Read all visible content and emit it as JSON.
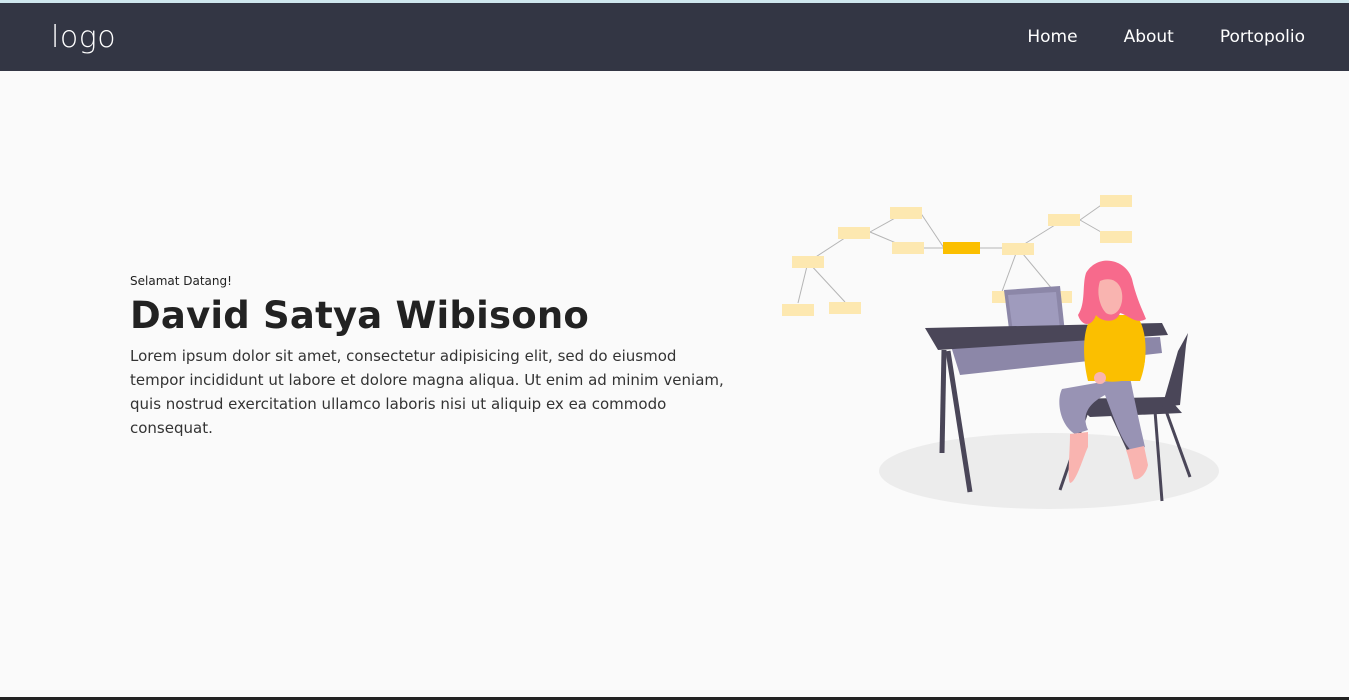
{
  "navbar": {
    "logo": "logo",
    "links": [
      {
        "label": "Home"
      },
      {
        "label": "About"
      },
      {
        "label": "Portopolio"
      }
    ]
  },
  "hero": {
    "greeting": "Selamat Datang!",
    "name": "David Satya Wibisono",
    "description": "Lorem ipsum dolor sit amet, consectetur adipisicing elit, sed do eiusmod tempor incididunt ut labore et dolore magna aliqua. Ut enim ad minim veniam, quis nostrud exercitation ullamco laboris nisi ut aliquip ex ea commodo consequat."
  },
  "illustration": {
    "name": "woman-at-desk-illustration",
    "colors": {
      "accent": "#fbbf00",
      "note": "#fde8b0",
      "desk": "#4a4658",
      "drawer": "#8c87a8",
      "hair": "#f76a8c",
      "skin": "#f9b4b0",
      "pants": "#9893b4",
      "shadow": "#ececec"
    }
  },
  "colors": {
    "navbar_bg": "#333644",
    "page_bg": "#fafafa",
    "text": "#222222"
  }
}
